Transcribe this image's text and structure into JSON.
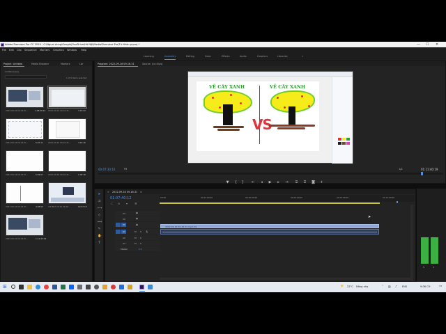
{
  "window": {
    "title": "Adobe Premiere Pro CC 2019 - C:\\Nguoi dung\\Google\\OneDrive\\Hà Nội\\Media\\Premiere Pro\\Tư Nhân.prproj *"
  },
  "menu": [
    "File",
    "Edit",
    "Clip",
    "Sequence",
    "Markers",
    "Graphics",
    "Window",
    "Help"
  ],
  "workspaces": {
    "items": [
      "Learning",
      "Assembly",
      "Editing",
      "Color",
      "Effects",
      "Audio",
      "Graphics",
      "Libraries"
    ],
    "active": "Assembly",
    "more": "»"
  },
  "project_panel": {
    "tabs": [
      "Project: Untitled",
      "Media Browser",
      "Markers",
      "Lbr"
    ],
    "file_name": "Untitled.prproj",
    "selection_info": "1 of 9 items selected",
    "clips": [
      {
        "label": "2022-09-16 09-16-31...",
        "duration": "1:28:00:12"
      },
      {
        "label": "2022-09-16 09-16-31...",
        "duration": "3:15:22"
      },
      {
        "label": "2022-09-16 09-16-31...",
        "duration": "5:07:11"
      },
      {
        "label": "2022-09-16 09-16-31...",
        "duration": "3:15:16"
      },
      {
        "label": "2022-09-16 09-16-31...",
        "duration": "5:59:07"
      },
      {
        "label": "2022-09-16 09-16-31...",
        "duration": "1:09:18"
      },
      {
        "label": "2022-09-16 09-16-31...",
        "duration": "4:48:05"
      },
      {
        "label": "VID 897 20-31 09-16...",
        "duration": "12:07:19"
      },
      {
        "label": "2022-09-16 09-16-31...",
        "duration": "1:11:43:19"
      }
    ]
  },
  "program_monitor": {
    "tab": "Program: 2022-09-16 09-16-31",
    "other_tab": "Source: (no clips)",
    "timecode": "00:07:30:16",
    "fit": "Fit",
    "quality": "1/2",
    "duration": "01:11:40:19",
    "drawing": {
      "left_title": "VẼ CÂY XANH",
      "right_title": "VẼ CÂY XANH",
      "center_text": "VS"
    }
  },
  "timeline": {
    "tab": "2022-09-16 09-16-31",
    "timecode": "01:07:40:12",
    "ruler": [
      "00:00",
      "00:15:00:00",
      "00:30:00:00",
      "00:45:00:00",
      "01:00:00:00",
      "01:15:00:00"
    ],
    "tracks": {
      "video": [
        "V3",
        "V2",
        "V1"
      ],
      "audio": [
        "A1",
        "A2",
        "A3"
      ],
      "master": "Master",
      "master_value": "0.0"
    },
    "video_clip_label": "2022-09-16 09-16-31.mp4 [V]",
    "playhead_fraction": 0.93
  },
  "audio_meter": {
    "labels": [
      "S",
      "S"
    ]
  },
  "taskbar": {
    "weather": "22°C",
    "weather_text": "Nắng nhẹ",
    "language": "ENG",
    "time": "9:06 CH",
    "date": ""
  },
  "colors": {
    "accent": "#4a8fe0",
    "clip_video": "#8fa7d6",
    "clip_audio": "#2d3b5a",
    "meter_green": "#3cb043"
  }
}
